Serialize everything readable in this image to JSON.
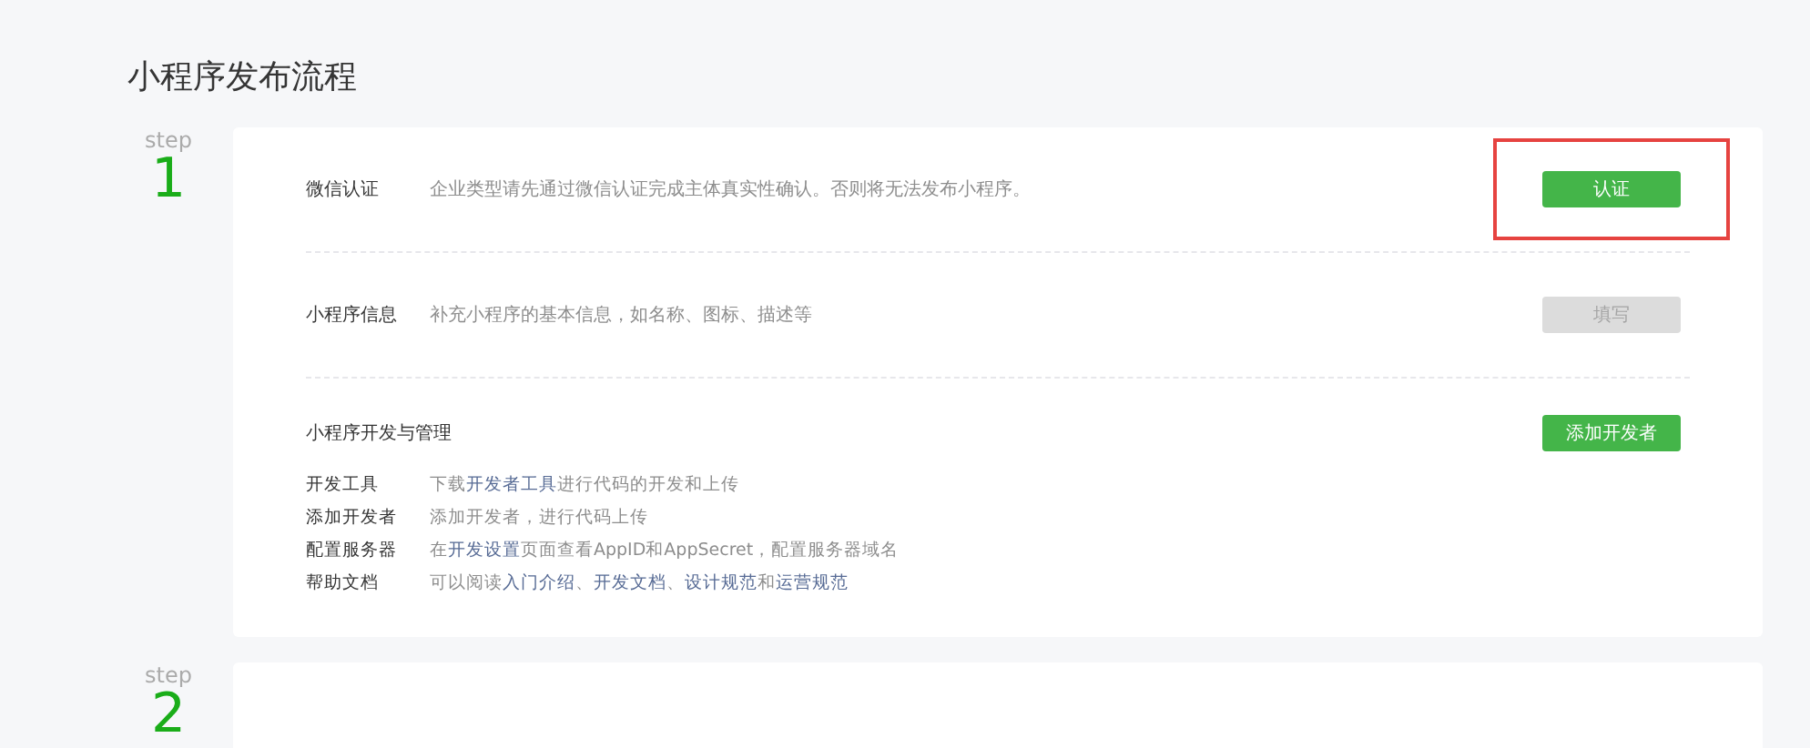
{
  "page_title": "小程序发布流程",
  "steps": [
    {
      "step_label": "step",
      "number": "1",
      "sections": [
        {
          "kind": "row",
          "label": "微信认证",
          "description": "企业类型请先通过微信认证完成主体真实性确认。否则将无法发布小程序。",
          "button": {
            "label": "认证",
            "disabled": false,
            "highlighted": true
          }
        },
        {
          "kind": "row",
          "label": "小程序信息",
          "description": "补充小程序的基本信息，如名称、图标、描述等",
          "button": {
            "label": "填写",
            "disabled": true,
            "highlighted": false
          }
        },
        {
          "kind": "list",
          "label": "小程序开发与管理",
          "button": {
            "label": "添加开发者",
            "disabled": false,
            "highlighted": false
          },
          "items": [
            {
              "term": "开发工具",
              "parts": [
                {
                  "text": "下载",
                  "link": false
                },
                {
                  "text": "开发者工具",
                  "link": true
                },
                {
                  "text": "进行代码的开发和上传",
                  "link": false
                }
              ]
            },
            {
              "term": "添加开发者",
              "parts": [
                {
                  "text": "添加开发者，进行代码上传",
                  "link": false
                }
              ]
            },
            {
              "term": "配置服务器",
              "parts": [
                {
                  "text": "在",
                  "link": false
                },
                {
                  "text": "开发设置",
                  "link": true
                },
                {
                  "text": "页面查看AppID和AppSecret，配置服务器域名",
                  "link": false
                }
              ]
            },
            {
              "term": "帮助文档",
              "parts": [
                {
                  "text": "可以阅读",
                  "link": false
                },
                {
                  "text": "入门介绍",
                  "link": true
                },
                {
                  "text": "、",
                  "link": false
                },
                {
                  "text": "开发文档",
                  "link": true
                },
                {
                  "text": "、",
                  "link": false
                },
                {
                  "text": "设计规范",
                  "link": true
                },
                {
                  "text": "和",
                  "link": false
                },
                {
                  "text": "运营规范",
                  "link": true
                }
              ]
            }
          ]
        }
      ]
    },
    {
      "step_label": "step",
      "number": "2"
    }
  ]
}
